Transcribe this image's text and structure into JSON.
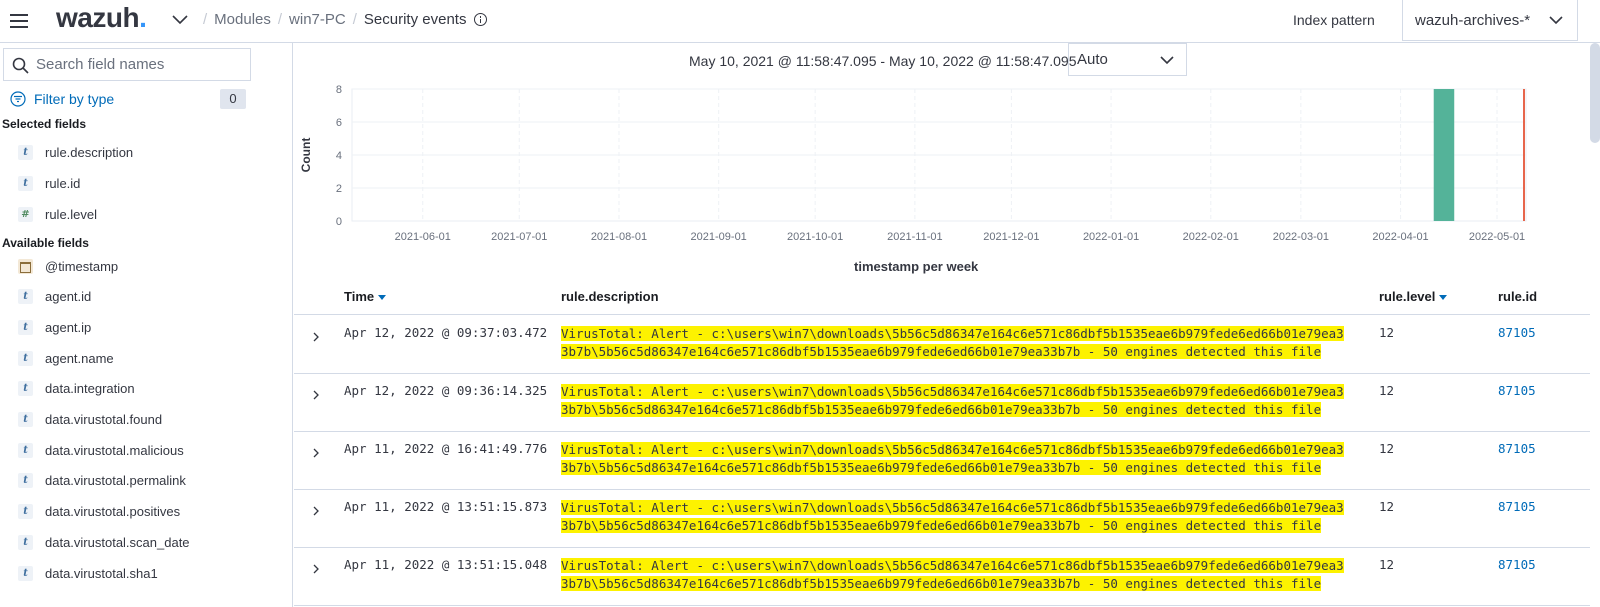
{
  "header": {
    "logo_text": "wazuh",
    "logo_dot": ".",
    "breadcrumbs": [
      "Modules",
      "win7-PC"
    ],
    "current_page": "Security events",
    "index_pattern_label": "Index pattern",
    "index_pattern_value": "wazuh-archives-*"
  },
  "sidebar": {
    "search_placeholder": "Search field names",
    "filter_label": "Filter by type",
    "filter_count": "0",
    "selected_heading": "Selected fields",
    "selected_fields": [
      {
        "type": "t",
        "name": "rule.description"
      },
      {
        "type": "t",
        "name": "rule.id"
      },
      {
        "type": "#",
        "name": "rule.level"
      }
    ],
    "available_heading": "Available fields",
    "available_fields": [
      {
        "type": "date",
        "name": "@timestamp"
      },
      {
        "type": "t",
        "name": "agent.id"
      },
      {
        "type": "t",
        "name": "agent.ip"
      },
      {
        "type": "t",
        "name": "agent.name"
      },
      {
        "type": "t",
        "name": "data.integration"
      },
      {
        "type": "t",
        "name": "data.virustotal.found"
      },
      {
        "type": "t",
        "name": "data.virustotal.malicious"
      },
      {
        "type": "t",
        "name": "data.virustotal.permalink"
      },
      {
        "type": "t",
        "name": "data.virustotal.positives"
      },
      {
        "type": "t",
        "name": "data.virustotal.scan_date"
      },
      {
        "type": "t",
        "name": "data.virustotal.sha1"
      }
    ]
  },
  "main": {
    "date_range": "May 10, 2021 @ 11:58:47.095 - May 10, 2022 @ 11:58:47.095",
    "interval": "Auto"
  },
  "chart_data": {
    "type": "bar",
    "ylabel": "Count",
    "xlabel": "timestamp per week",
    "ylim": [
      0,
      8
    ],
    "yticks": [
      0,
      2,
      4,
      6,
      8
    ],
    "xticks": [
      "2021-06-01",
      "2021-07-01",
      "2021-08-01",
      "2021-09-01",
      "2021-10-01",
      "2021-11-01",
      "2021-12-01",
      "2022-01-01",
      "2022-02-01",
      "2022-03-01",
      "2022-04-01",
      "2022-05-01"
    ],
    "x_range": [
      "2021-05-10",
      "2022-05-10"
    ],
    "bars": [
      {
        "week_start": "2022-04-11",
        "count": 8
      }
    ],
    "bar_color": "#54b399",
    "now_marker": "2022-05-10",
    "now_marker_color": "#e7664c",
    "grid": true
  },
  "table": {
    "columns": {
      "time": "Time",
      "description": "rule.description",
      "level": "rule.level",
      "id": "rule.id"
    },
    "rows": [
      {
        "time": "Apr 12, 2022 @ 09:37:03.472",
        "description": "VirusTotal: Alert - c:\\users\\win7\\downloads\\5b56c5d86347e164c6e571c86dbf5b1535eae6b979fede6ed66b01e79ea33b7b\\5b56c5d86347e164c6e571c86dbf5b1535eae6b979fede6ed66b01e79ea33b7b - 50 engines detected this file",
        "level": "12",
        "id": "87105"
      },
      {
        "time": "Apr 12, 2022 @ 09:36:14.325",
        "description": "VirusTotal: Alert - c:\\users\\win7\\downloads\\5b56c5d86347e164c6e571c86dbf5b1535eae6b979fede6ed66b01e79ea33b7b\\5b56c5d86347e164c6e571c86dbf5b1535eae6b979fede6ed66b01e79ea33b7b - 50 engines detected this file",
        "level": "12",
        "id": "87105"
      },
      {
        "time": "Apr 11, 2022 @ 16:41:49.776",
        "description": "VirusTotal: Alert - c:\\users\\win7\\downloads\\5b56c5d86347e164c6e571c86dbf5b1535eae6b979fede6ed66b01e79ea33b7b\\5b56c5d86347e164c6e571c86dbf5b1535eae6b979fede6ed66b01e79ea33b7b - 50 engines detected this file",
        "level": "12",
        "id": "87105"
      },
      {
        "time": "Apr 11, 2022 @ 13:51:15.873",
        "description": "VirusTotal: Alert - c:\\users\\win7\\downloads\\5b56c5d86347e164c6e571c86dbf5b1535eae6b979fede6ed66b01e79ea33b7b\\5b56c5d86347e164c6e571c86dbf5b1535eae6b979fede6ed66b01e79ea33b7b - 50 engines detected this file",
        "level": "12",
        "id": "87105"
      },
      {
        "time": "Apr 11, 2022 @ 13:51:15.048",
        "description": "VirusTotal: Alert - c:\\users\\win7\\downloads\\5b56c5d86347e164c6e571c86dbf5b1535eae6b979fede6ed66b01e79ea33b7b\\5b56c5d86347e164c6e571c86dbf5b1535eae6b979fede6ed66b01e79ea33b7b - 50 engines detected this file",
        "level": "12",
        "id": "87105"
      }
    ]
  }
}
